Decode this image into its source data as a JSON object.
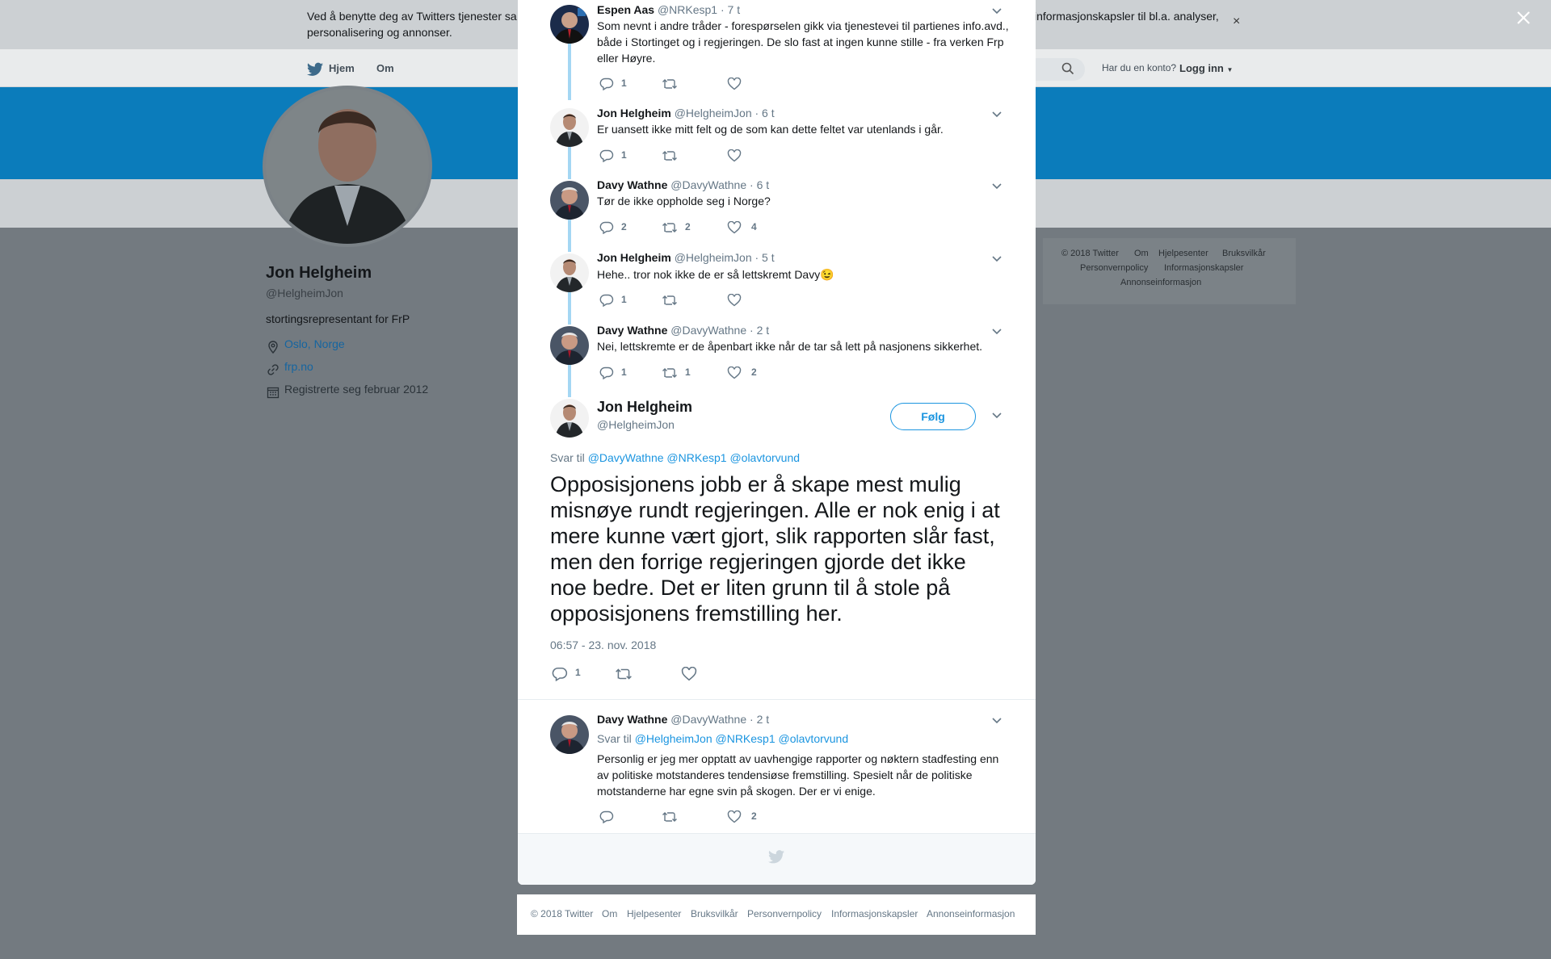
{
  "cookie_bar": {
    "text_left": "Ved å benytte deg av Twitters tjenester sa",
    "text_right": "informasjonskapsler til bl.a. analyser,",
    "text_second_line": "personalisering og annonser.",
    "close_glyph": "×"
  },
  "nav": {
    "home": "Hjem",
    "about": "Om",
    "login_question": "Har du en konto?",
    "login": "Logg inn"
  },
  "profile": {
    "name": "Jon Helgheim",
    "handle": "@HelgheimJon",
    "bio": "stortingsrepresentant for FrP",
    "location": "Oslo, Norge",
    "website": "frp.no",
    "joined": "Registrerte seg februar 2012"
  },
  "side_footer": {
    "copyright": "© 2018 Twitter",
    "about": "Om",
    "help": "Hjelpesenter",
    "terms": "Bruksvilkår",
    "privacy": "Personvernpolicy",
    "cookies": "Informasjonskapsler",
    "ads": "Annonseinformasjon"
  },
  "thread": [
    {
      "name": "Espen Aas",
      "handle": "@NRKesp1",
      "time": "· 7 t",
      "text": "Som nevnt i andre tråder - forespørselen gikk via tjenestevei til partienes info.avd., både i Stortinget og i regjeringen. De slo fast at ingen kunne stille - fra verken Frp eller Høyre.",
      "replies": "1",
      "retweets": "",
      "likes": ""
    },
    {
      "name": "Jon Helgheim",
      "handle": "@HelgheimJon",
      "time": "· 6 t",
      "text": "Er uansett ikke mitt felt og de som kan dette feltet var utenlands i går.",
      "replies": "1",
      "retweets": "",
      "likes": ""
    },
    {
      "name": "Davy Wathne",
      "handle": "@DavyWathne",
      "time": "· 6 t",
      "text": "Tør de ikke oppholde seg i Norge?",
      "replies": "2",
      "retweets": "2",
      "likes": "4"
    },
    {
      "name": "Jon Helgheim",
      "handle": "@HelgheimJon",
      "time": "· 5 t",
      "text": "Hehe.. tror nok ikke de er så lettskremt Davy😉",
      "replies": "1",
      "retweets": "",
      "likes": ""
    },
    {
      "name": "Davy Wathne",
      "handle": "@DavyWathne",
      "time": "· 2 t",
      "text": "Nei, lettskremte er de åpenbart ikke når de tar så lett på nasjonens sikkerhet.",
      "replies": "1",
      "retweets": "1",
      "likes": "2"
    }
  ],
  "focus": {
    "name": "Jon Helgheim",
    "handle": "@HelgheimJon",
    "follow": "Følg",
    "reply_to_label": "Svar til",
    "reply_to_1": "@DavyWathne",
    "reply_to_2": "@NRKesp1",
    "reply_to_3": "@olavtorvund",
    "text": "Opposisjonens jobb er å skape mest mulig misnøye rundt regjeringen. Alle er nok enig i at mere kunne vært gjort, slik rapporten slår fast, men den forrige regjeringen gjorde det ikke noe bedre. Det er liten grunn til å stole på opposisjonens fremstilling her.",
    "timestamp": "06:57 - 23. nov. 2018",
    "replies": "1"
  },
  "reply": {
    "name": "Davy Wathne",
    "handle": "@DavyWathne",
    "time": "· 2 t",
    "reply_to_label": "Svar til",
    "reply_to_1": "@HelgheimJon",
    "reply_to_2": "@NRKesp1",
    "reply_to_3": "@olavtorvund",
    "text": "Personlig er jeg mer opptatt av uavhengige rapporter og nøktern stadfesting enn av politiske motstanderes tendensiøse fremstilling. Spesielt når de politiske motstanderne har egne svin på skogen. Der er vi enige.",
    "likes": "2"
  },
  "footer": {
    "copyright": "© 2018 Twitter",
    "about": "Om",
    "help": "Hjelpesenter",
    "terms": "Bruksvilkår",
    "privacy": "Personvernpolicy",
    "cookies": "Informasjonskapsler",
    "ads": "Annonseinformasjon"
  },
  "colors": {
    "accent": "#1b95e0",
    "banner": "#0b7cbb",
    "thread_line": "#a4d7f3",
    "backdrop": "#737a80"
  }
}
